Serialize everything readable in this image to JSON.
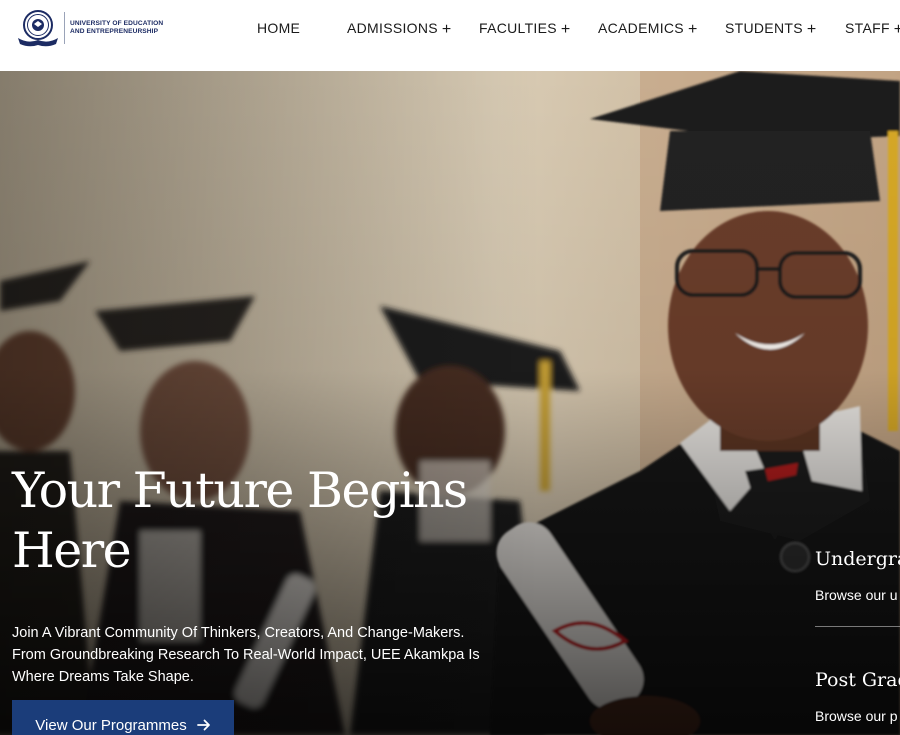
{
  "header": {
    "logo_text_line1": "UNIVERSITY OF EDUCATION",
    "logo_text_line2": "AND ENTREPRENEURSHIP",
    "nav": [
      {
        "label": "HOME",
        "has_submenu": false
      },
      {
        "label": "ADMISSIONS",
        "has_submenu": true
      },
      {
        "label": "FACULTIES",
        "has_submenu": true
      },
      {
        "label": "ACADEMICS",
        "has_submenu": true
      },
      {
        "label": "STUDENTS",
        "has_submenu": true
      },
      {
        "label": "STAFF",
        "has_submenu": true
      }
    ],
    "submenu_glyph": "+"
  },
  "hero": {
    "title_line1": "Your Future Begins",
    "title_line2": "Here",
    "description_line1": "Join A Vibrant Community Of Thinkers, Creators, And Change-Makers.",
    "description_line2": "From Groundbreaking Research To Real-World Impact, UEE Akamkpa Is",
    "description_line3": "Where Dreams Take Shape.",
    "cta_label": "View Our Programmes",
    "cta_icon": "arrow-right-icon",
    "side_cards": [
      {
        "title": "Undergrad",
        "subtitle": "Browse our u"
      },
      {
        "title": "Post Grad",
        "subtitle": "Browse our p"
      }
    ]
  },
  "colors": {
    "brand_navy": "#1b3d7a",
    "logo_navy": "#1c2b63",
    "hero_text": "#ffffff"
  }
}
